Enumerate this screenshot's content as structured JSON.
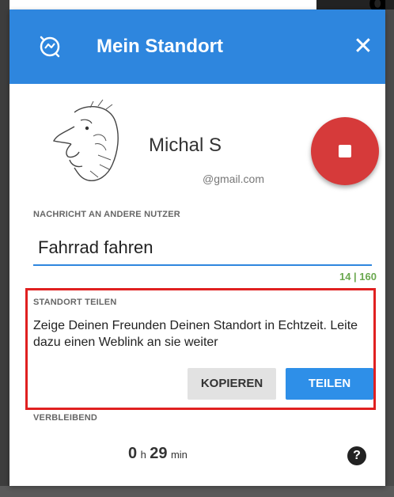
{
  "corner_text": "g",
  "dialog": {
    "title": "Mein Standort",
    "close_glyph": "✕",
    "header_color": "#2e86de"
  },
  "profile": {
    "name": "Michal S",
    "email": "@gmail.com",
    "stop_button_color": "#d63a3a"
  },
  "message": {
    "label": "NACHRICHT AN ANDERE NUTZER",
    "value": "Fahrrad fahren",
    "counter": "14 | 160"
  },
  "share": {
    "label": "STANDORT TEILEN",
    "description": "Zeige Deinen Freunden Deinen Standort in Echtzeit. Leite dazu einen Weblink an sie weiter",
    "copy_label": "KOPIEREN",
    "share_label": "TEILEN",
    "highlight_color": "#e02020"
  },
  "remaining": {
    "label": "VERBLEIBEND",
    "hours": "0",
    "hours_unit": "h",
    "minutes": "29",
    "minutes_unit": "min",
    "help_glyph": "?"
  }
}
